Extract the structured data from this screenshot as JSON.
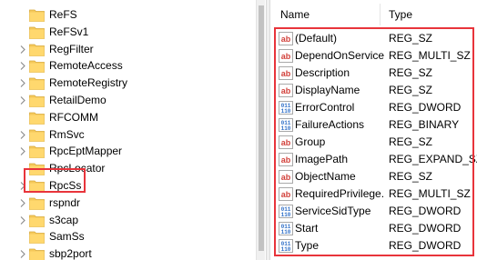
{
  "tree": {
    "items": [
      {
        "label": "ReFS",
        "expandable": false
      },
      {
        "label": "ReFSv1",
        "expandable": false
      },
      {
        "label": "RegFilter",
        "expandable": true
      },
      {
        "label": "RemoteAccess",
        "expandable": true
      },
      {
        "label": "RemoteRegistry",
        "expandable": true
      },
      {
        "label": "RetailDemo",
        "expandable": true
      },
      {
        "label": "RFCOMM",
        "expandable": false
      },
      {
        "label": "RmSvc",
        "expandable": true
      },
      {
        "label": "RpcEptMapper",
        "expandable": true
      },
      {
        "label": "RpcLocator",
        "expandable": false
      },
      {
        "label": "RpcSs",
        "expandable": true,
        "selected": true
      },
      {
        "label": "rspndr",
        "expandable": true
      },
      {
        "label": "s3cap",
        "expandable": true
      },
      {
        "label": "SamSs",
        "expandable": false
      },
      {
        "label": "sbp2port",
        "expandable": true
      }
    ]
  },
  "values": {
    "columns": {
      "name": "Name",
      "type": "Type"
    },
    "rows": [
      {
        "name": "(Default)",
        "type": "REG_SZ",
        "icon": "string-value-icon"
      },
      {
        "name": "DependOnService",
        "type": "REG_MULTI_SZ",
        "icon": "string-value-icon"
      },
      {
        "name": "Description",
        "type": "REG_SZ",
        "icon": "string-value-icon"
      },
      {
        "name": "DisplayName",
        "type": "REG_SZ",
        "icon": "string-value-icon"
      },
      {
        "name": "ErrorControl",
        "type": "REG_DWORD",
        "icon": "binary-value-icon"
      },
      {
        "name": "FailureActions",
        "type": "REG_BINARY",
        "icon": "binary-value-icon"
      },
      {
        "name": "Group",
        "type": "REG_SZ",
        "icon": "string-value-icon"
      },
      {
        "name": "ImagePath",
        "type": "REG_EXPAND_SZ",
        "icon": "string-value-icon"
      },
      {
        "name": "ObjectName",
        "type": "REG_SZ",
        "icon": "string-value-icon"
      },
      {
        "name": "RequiredPrivilege...",
        "type": "REG_MULTI_SZ",
        "icon": "string-value-icon"
      },
      {
        "name": "ServiceSidType",
        "type": "REG_DWORD",
        "icon": "binary-value-icon"
      },
      {
        "name": "Start",
        "type": "REG_DWORD",
        "icon": "binary-value-icon"
      },
      {
        "name": "Type",
        "type": "REG_DWORD",
        "icon": "binary-value-icon"
      }
    ]
  },
  "colors": {
    "highlight": "#e8343b",
    "folder": "#f5c95a",
    "string_icon": "#d2413b",
    "binary_icon": "#2f6fc7"
  }
}
